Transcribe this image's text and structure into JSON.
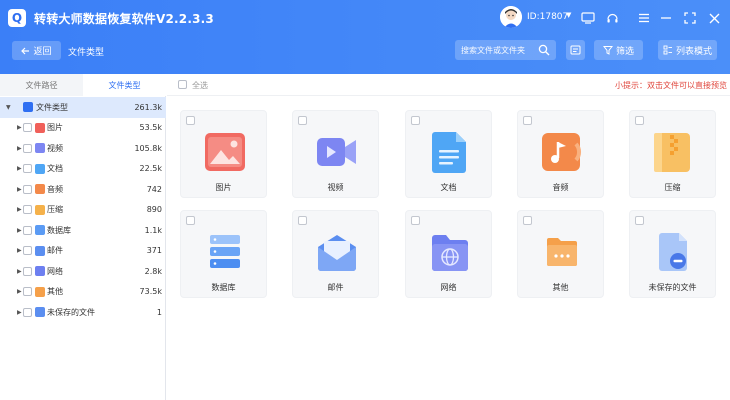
{
  "app": {
    "title": "转转大师数据恢复软件V2.2.3.3",
    "logo_letter": "Q",
    "user_id": "ID:17807",
    "user_caret": "▼"
  },
  "header": {
    "back_label": "返回",
    "crumb": "文件类型",
    "search_placeholder": "搜索文件或文件夹",
    "filter_label": "筛选",
    "list_mode_label": "列表模式"
  },
  "left": {
    "tabs": [
      "文件路径",
      "文件类型"
    ],
    "active_tab": 1,
    "root": {
      "label": "文件类型",
      "count": "261.3k"
    },
    "items": [
      {
        "label": "图片",
        "count": "53.5k",
        "color": "#f0605a"
      },
      {
        "label": "视频",
        "count": "105.8k",
        "color": "#7d86f2"
      },
      {
        "label": "文档",
        "count": "22.5k",
        "color": "#4fa6f5"
      },
      {
        "label": "音频",
        "count": "742",
        "color": "#f3894a"
      },
      {
        "label": "压缩",
        "count": "890",
        "color": "#f5b14a"
      },
      {
        "label": "数据库",
        "count": "1.1k",
        "color": "#5b9bf4"
      },
      {
        "label": "邮件",
        "count": "371",
        "color": "#5b8ef0"
      },
      {
        "label": "网络",
        "count": "2.8k",
        "color": "#6d7ff0"
      },
      {
        "label": "其他",
        "count": "73.5k",
        "color": "#f5a04a"
      },
      {
        "label": "未保存的文件",
        "count": "1",
        "color": "#5b8ef0"
      }
    ]
  },
  "main": {
    "select_all": "全选",
    "hint": "小提示：双击文件可以直接预览",
    "cards": [
      {
        "label": "图片",
        "icon": "image-icon"
      },
      {
        "label": "视频",
        "icon": "video-icon"
      },
      {
        "label": "文档",
        "icon": "document-icon"
      },
      {
        "label": "音频",
        "icon": "audio-icon"
      },
      {
        "label": "压缩",
        "icon": "archive-icon"
      },
      {
        "label": "数据库",
        "icon": "database-icon"
      },
      {
        "label": "邮件",
        "icon": "mail-icon"
      },
      {
        "label": "网络",
        "icon": "network-icon"
      },
      {
        "label": "其他",
        "icon": "other-folder-icon"
      },
      {
        "label": "未保存的文件",
        "icon": "unsaved-file-icon"
      }
    ]
  },
  "colors": {
    "accent": "#3b7ff7",
    "hint": "#e0463c",
    "tree_selected_bg": "#dde9fd"
  }
}
